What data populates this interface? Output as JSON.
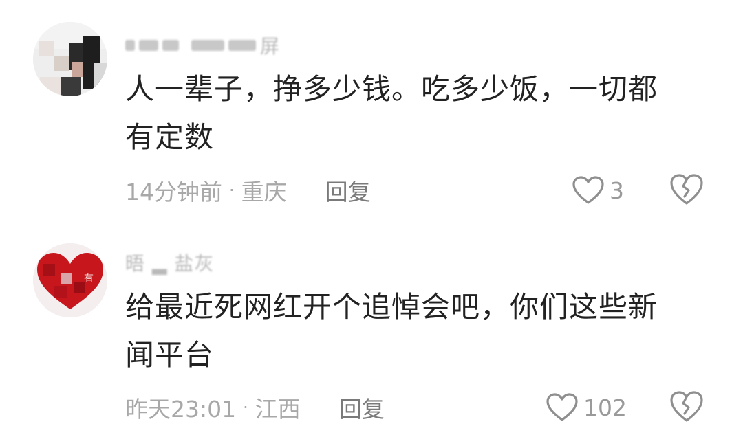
{
  "comments": [
    {
      "username": "▁▁▁ ▁▁▁▁屏",
      "text_line1": "人一辈子，挣多少钱。吃多少饭，一切都",
      "text_line2": "有定数",
      "time": "14分钟前",
      "location": "重庆",
      "reply_label": "回复",
      "likes": "3",
      "separator": "·"
    },
    {
      "username": "晤 ▂ 盐灰",
      "text_line1": "给最近死网红开个追悼会吧，你们这些新",
      "text_line2": "闻平台",
      "time": "昨天23:01",
      "location": "江西",
      "reply_label": "回复",
      "likes": "102",
      "separator": "·"
    }
  ],
  "icons": {
    "like": "heart-outline-icon",
    "dislike": "broken-heart-icon"
  },
  "colors": {
    "text": "#222222",
    "meta": "#a8a8a8",
    "reply": "#7a7a7a",
    "icon": "#8f8f8f",
    "avatar2_red": "#c8161d"
  }
}
